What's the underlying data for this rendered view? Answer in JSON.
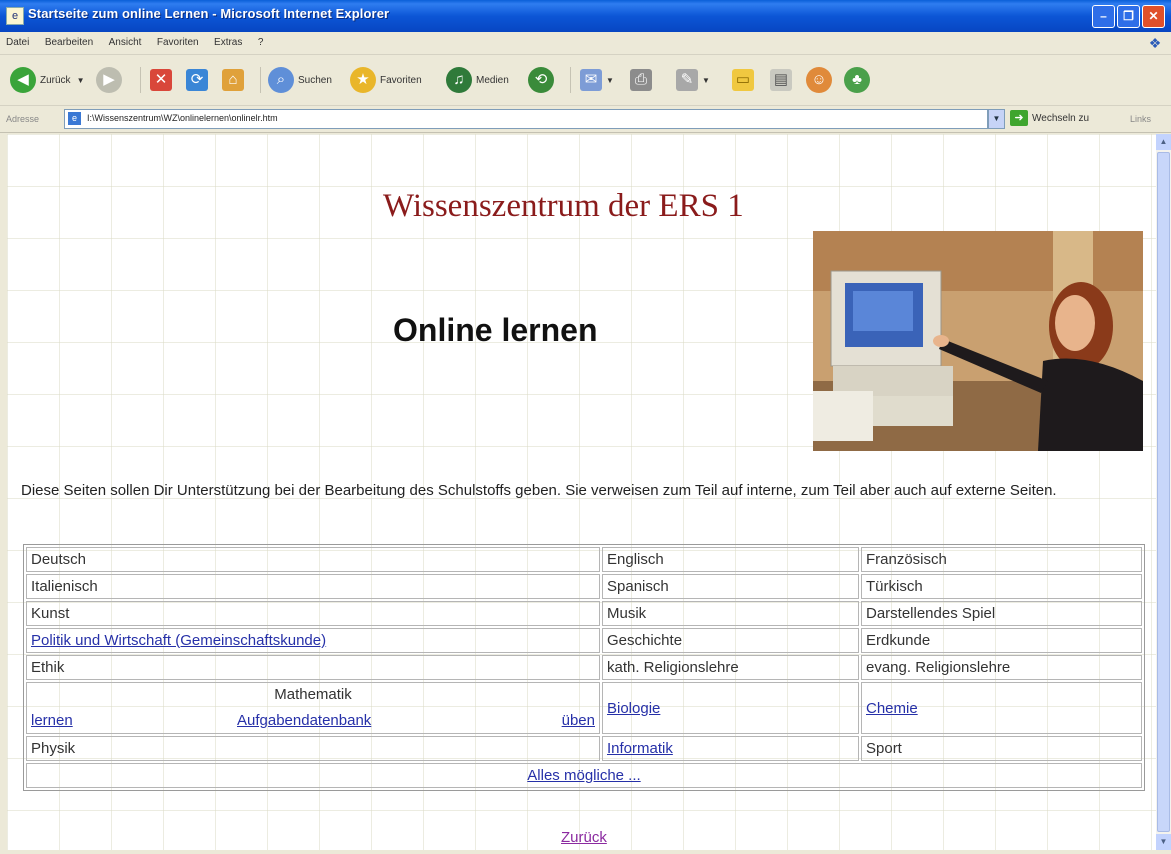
{
  "window": {
    "title": "Startseite zum online Lernen - Microsoft Internet Explorer"
  },
  "menu": [
    "Datei",
    "Bearbeiten",
    "Ansicht",
    "Favoriten",
    "Extras",
    "?"
  ],
  "toolbar": {
    "back": "Zurück",
    "search": "Suchen",
    "favorites": "Favoriten",
    "media": "Medien"
  },
  "address": {
    "label": "Adresse",
    "url": "I:\\Wissenszentrum\\WZ\\onlinelernen\\onlinelr.htm",
    "go": "Wechseln zu",
    "links": "Links"
  },
  "page": {
    "heading": "Wissenszentrum der ERS 1",
    "subheading": "Online lernen",
    "intro": "Diese Seiten sollen Dir Unterstützung bei der Bearbeitung des Schulstoffs geben. Sie verweisen zum Teil auf interne, zum Teil aber auch auf externe Seiten.",
    "rows": [
      [
        "Deutsch",
        "Englisch",
        "Französisch"
      ],
      [
        "Italienisch",
        "Spanisch",
        "Türkisch"
      ],
      [
        "Kunst",
        "Musik",
        "Darstellendes Spiel"
      ],
      [
        "Politik und Wirtschaft (Gemeinschaftskunde)",
        "Geschichte",
        "Erdkunde"
      ],
      [
        "Ethik",
        "kath. Religionslehre",
        "evang. Religionslehre"
      ]
    ],
    "math": {
      "title": "Mathematik",
      "lernen": "lernen",
      "db": "Aufgabendatenbank",
      "ueben": "üben"
    },
    "biology": "Biologie",
    "chemistry": "Chemie",
    "physics": "Physik",
    "informatics": "Informatik",
    "sport": "Sport",
    "misc": "Alles mögliche ...",
    "back": "Zurück"
  },
  "colors": {
    "heading": "#8a1b1b",
    "link": "#2630a8",
    "visited_link": "#8b2aa0",
    "titlebar": "#0c56d6"
  },
  "icons": [
    "back-icon",
    "forward-icon",
    "stop-icon",
    "refresh-icon",
    "home-icon",
    "search-icon",
    "favorites-icon",
    "media-icon",
    "history-icon",
    "mail-icon",
    "print-icon",
    "edit-icon",
    "folder-icon",
    "messenger-icon"
  ]
}
